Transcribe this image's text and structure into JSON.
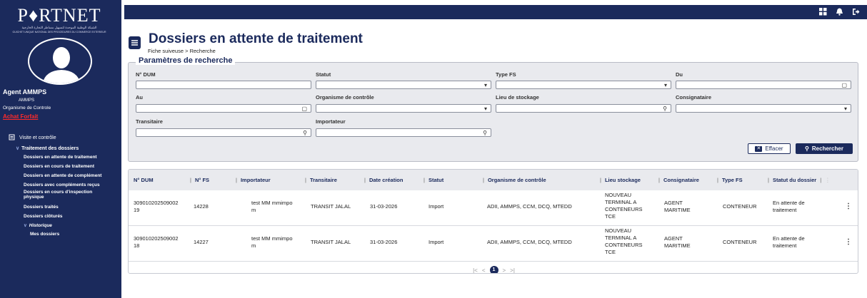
{
  "sidebar": {
    "logo": "P♦RTNET",
    "logo_sub": "الشبكة الوطنية الموحدة لتسهيل مساطر التجارة الخارجية",
    "logo_sub2": "GUICHET UNIQUE NATIONAL DES PROCEDURES DU COMMERCE EXTERIEUR",
    "user_name": "Agent AMMPS",
    "user_org": "AMMPS",
    "user_role": "Organisme de Controle",
    "user_link": "Achat Forfait",
    "section": "Visite et contrôle",
    "group": "Traitement des dossiers",
    "items": [
      {
        "label": "Dossiers en attente de traitement"
      },
      {
        "label": "Dossiers en cours de traitement"
      },
      {
        "label": "Dossiers en attente de complément"
      },
      {
        "label": "Dossiers avec compléments reçus"
      },
      {
        "label": "Dossiers en cours d'inspection physique"
      },
      {
        "label": "Dossiers traités"
      },
      {
        "label": "Dossiers clôturés"
      }
    ],
    "subgroup": "Historique",
    "sub_items": [
      {
        "label": "Mes dossiers"
      }
    ]
  },
  "topbar": {
    "icons": [
      "grid-icon",
      "bell-icon",
      "logout-icon"
    ],
    "color": "#1b2a5c"
  },
  "page": {
    "title": "Dossiers en attente de traitement",
    "breadcrumb": "Fiche suiveuse > Recherche"
  },
  "search": {
    "legend": "Paramètres de recherche",
    "fields": {
      "num_dum": {
        "label": "N° DUM",
        "value": ""
      },
      "statut": {
        "label": "Statut",
        "value": ""
      },
      "type_fs": {
        "label": "Type FS",
        "value": ""
      },
      "du": {
        "label": "Du",
        "value": ""
      },
      "au": {
        "label": "Au",
        "value": ""
      },
      "organisme": {
        "label": "Organisme de contrôle",
        "value": ""
      },
      "lieu": {
        "label": "Lieu de stockage",
        "value": ""
      },
      "consignataire": {
        "label": "Consignataire",
        "value": ""
      },
      "transitaire": {
        "label": "Transitaire",
        "value": ""
      },
      "importateur": {
        "label": "Importateur",
        "value": ""
      }
    },
    "clear_label": "Effacer",
    "search_label": "Rechercher"
  },
  "table": {
    "columns": [
      "N° DUM",
      "N° FS",
      "Importateur",
      "Transitaire",
      "Date création",
      "Statut",
      "Organisme de contrôle",
      "Lieu stockage",
      "Consignataire",
      "Type FS",
      "Statut du dossier"
    ],
    "rows": [
      {
        "dum": [
          "309010202509002",
          "19"
        ],
        "fs": "14228",
        "importateur": [
          "test MM mmimpo",
          "m"
        ],
        "transitaire": "TRANSIT JALAL",
        "date": "31-03-2026",
        "statut": "Import",
        "organisme": "ADII, AMMPS, CCM, DCQ, MTEDD",
        "lieu": [
          "NOUVEAU",
          "TERMINAL A",
          "CONTENEURS",
          "TCE"
        ],
        "consignataire": [
          "AGENT",
          "MARITIME"
        ],
        "type_fs": "CONTENEUR",
        "statut_dossier": [
          "En attente de",
          "traitement"
        ]
      },
      {
        "dum": [
          "309010202509002",
          "18"
        ],
        "fs": "14227",
        "importateur": [
          "test MM mmimpo",
          "m"
        ],
        "transitaire": "TRANSIT JALAL",
        "date": "31-03-2026",
        "statut": "Import",
        "organisme": "ADII, AMMPS, CCM, DCQ, MTEDD",
        "lieu": [
          "NOUVEAU",
          "TERMINAL A",
          "CONTENEURS",
          "TCE"
        ],
        "consignataire": [
          "AGENT",
          "MARITIME"
        ],
        "type_fs": "CONTENEUR",
        "statut_dossier": [
          "En attente de",
          "traitement"
        ]
      }
    ],
    "pagination": {
      "first": "|<",
      "prev": "<",
      "current": "1",
      "next": ">",
      "last": ">|"
    }
  }
}
